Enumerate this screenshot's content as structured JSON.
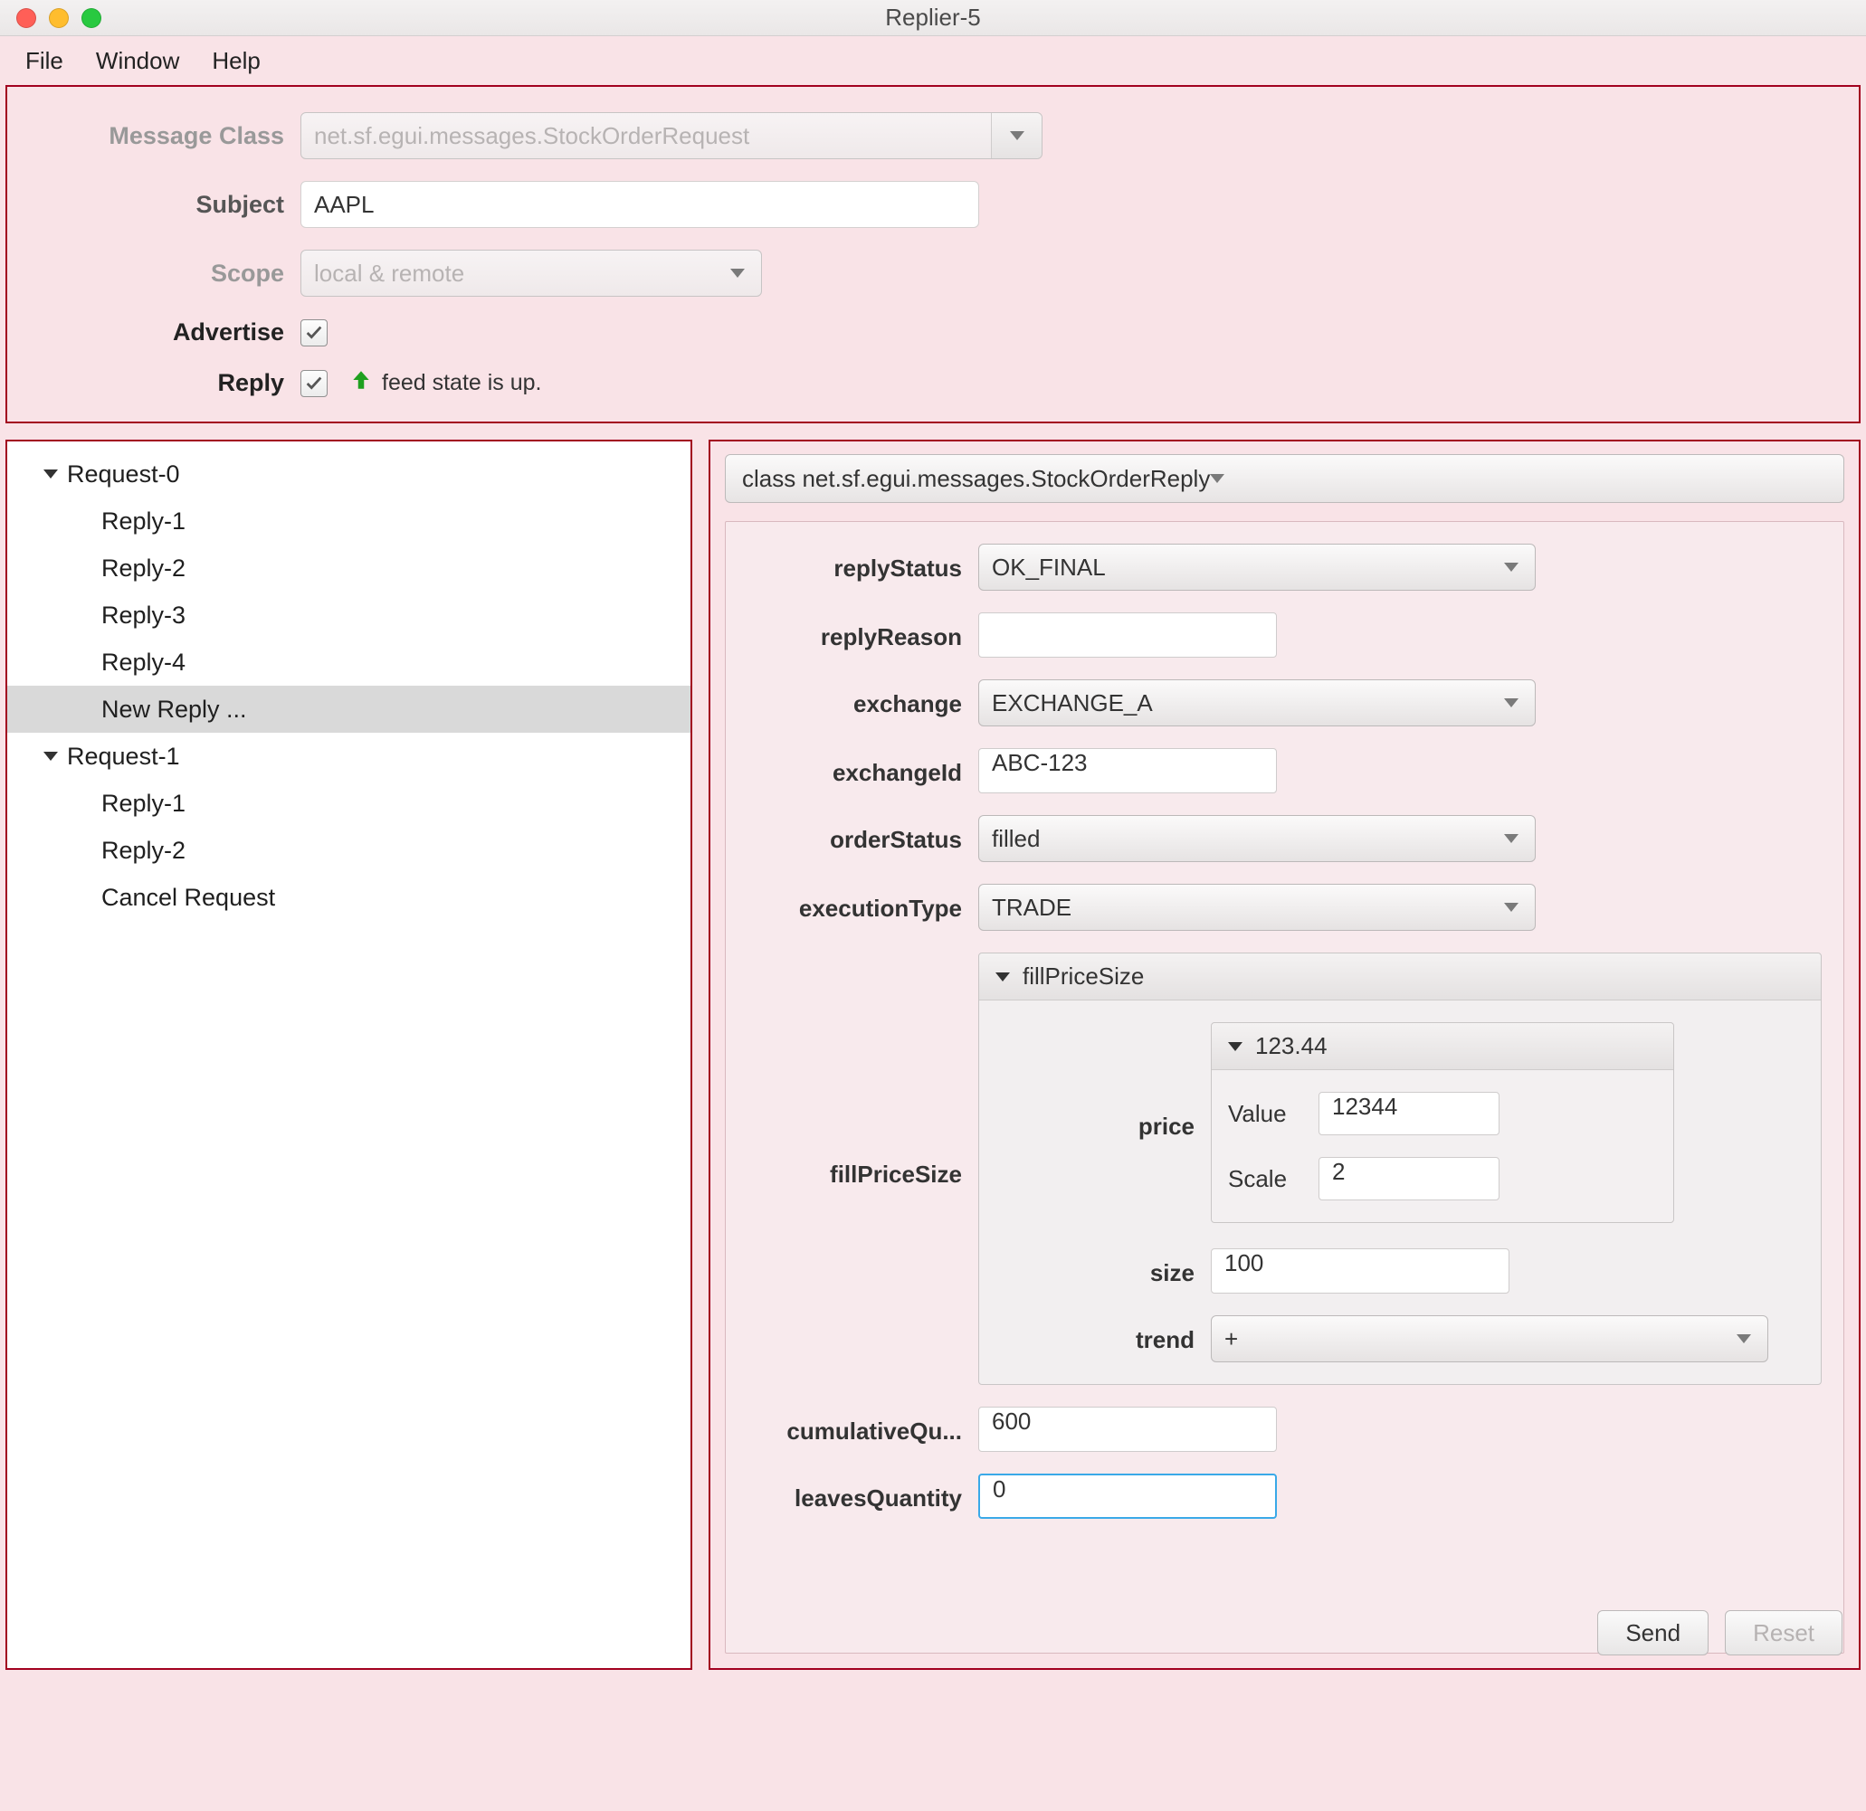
{
  "window": {
    "title": "Replier-5"
  },
  "menu": {
    "file": "File",
    "window": "Window",
    "help": "Help"
  },
  "top": {
    "labels": {
      "messageClass": "Message Class",
      "subject": "Subject",
      "scope": "Scope",
      "advertise": "Advertise",
      "reply": "Reply"
    },
    "messageClass": "net.sf.egui.messages.StockOrderRequest",
    "subject": "AAPL",
    "scope": "local & remote",
    "advertise": true,
    "reply": true,
    "feedState": "feed state is up."
  },
  "tree": {
    "nodes": [
      {
        "label": "Request-0",
        "expanded": true,
        "children": [
          {
            "label": "Reply-1"
          },
          {
            "label": "Reply-2"
          },
          {
            "label": "Reply-3"
          },
          {
            "label": "Reply-4"
          },
          {
            "label": "New Reply ...",
            "selected": true
          }
        ]
      },
      {
        "label": "Request-1",
        "expanded": true,
        "children": [
          {
            "label": "Reply-1"
          },
          {
            "label": "Reply-2"
          },
          {
            "label": "Cancel Request"
          }
        ]
      }
    ]
  },
  "right": {
    "classSelect": "class net.sf.egui.messages.StockOrderReply",
    "fields": {
      "replyStatus": {
        "label": "replyStatus",
        "value": "OK_FINAL"
      },
      "replyReason": {
        "label": "replyReason",
        "value": ""
      },
      "exchange": {
        "label": "exchange",
        "value": "EXCHANGE_A"
      },
      "exchangeId": {
        "label": "exchangeId",
        "value": "ABC-123"
      },
      "orderStatus": {
        "label": "orderStatus",
        "value": "filled"
      },
      "executionType": {
        "label": "executionType",
        "value": "TRADE"
      },
      "fillPriceSize": {
        "label": "fillPriceSize",
        "groupTitle": "fillPriceSize",
        "price": {
          "label": "price",
          "innerTitle": "123.44",
          "value": {
            "label": "Value",
            "v": "12344"
          },
          "scale": {
            "label": "Scale",
            "v": "2"
          }
        },
        "size": {
          "label": "size",
          "value": "100"
        },
        "trend": {
          "label": "trend",
          "value": "+"
        }
      },
      "cumulativeQuantity": {
        "label": "cumulativeQu...",
        "value": "600"
      },
      "leavesQuantity": {
        "label": "leavesQuantity",
        "value": "0"
      }
    },
    "buttons": {
      "send": "Send",
      "reset": "Reset"
    }
  }
}
